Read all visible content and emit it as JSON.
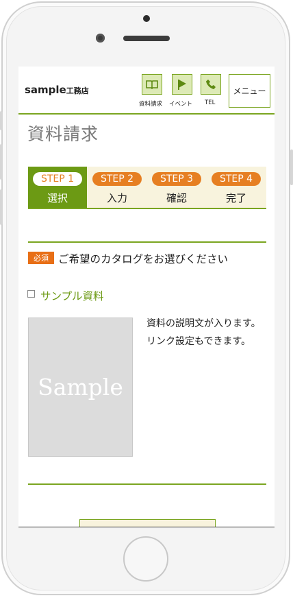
{
  "header": {
    "logo_main": "sample",
    "logo_sub": "工務店",
    "icons": [
      {
        "icon": "book-icon",
        "label": "資料請求"
      },
      {
        "icon": "flag-icon",
        "label": "イベント"
      },
      {
        "icon": "phone-icon",
        "label": "TEL"
      }
    ],
    "menu_label": "メニュー"
  },
  "page": {
    "title": "資料請求"
  },
  "steps": [
    {
      "badge": "STEP 1",
      "label": "選択",
      "active": true
    },
    {
      "badge": "STEP 2",
      "label": "入力",
      "active": false
    },
    {
      "badge": "STEP 3",
      "label": "確認",
      "active": false
    },
    {
      "badge": "STEP 4",
      "label": "完了",
      "active": false
    }
  ],
  "form": {
    "required_badge": "必須",
    "question": "ご希望のカタログをお選びください",
    "item_name": "サンプル資料",
    "thumbnail_text": "Sample",
    "description_line1": "資料の説明文が入ります。",
    "description_line2": "リンク設定もできます。"
  },
  "colors": {
    "accent_green": "#7aa520",
    "active_step": "#6c9a14",
    "step_pill": "#e67f22",
    "required_badge": "#e86f16"
  }
}
